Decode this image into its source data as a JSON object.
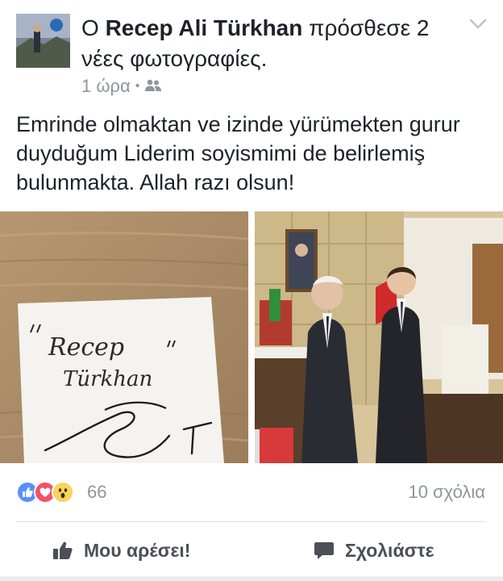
{
  "post": {
    "prefix": "Ο",
    "author": "Recep Ali Türkhan",
    "action": "πρόσθεσε 2 νέες φωτογραφίες.",
    "time": "1 ώρα",
    "separator": "•",
    "audience_icon": "friends-icon",
    "text": "Emrinde olmaktan ve izinde yürümekten gurur duyduğum Liderim soyismimi de belirlemiş bulunmakta. Allah razı olsun!"
  },
  "photos": {
    "left": {
      "icon": "handwritten-note-photo",
      "handwriting_line1": "Recep",
      "handwriting_line2": "Türkhan"
    },
    "right": {
      "icon": "office-meeting-photo"
    }
  },
  "reactions": {
    "icons": [
      "like-reaction-icon",
      "love-reaction-icon",
      "wow-reaction-icon"
    ],
    "count": "66",
    "comments": "10 σχόλια"
  },
  "actions": {
    "like_label": "Μου αρέσει!",
    "comment_label": "Σχολιάστε"
  },
  "colors": {
    "like": "#5890ff",
    "love": "#f25268",
    "wow": "#fbd35b",
    "text": "#1d2129",
    "meta": "#90949c"
  }
}
